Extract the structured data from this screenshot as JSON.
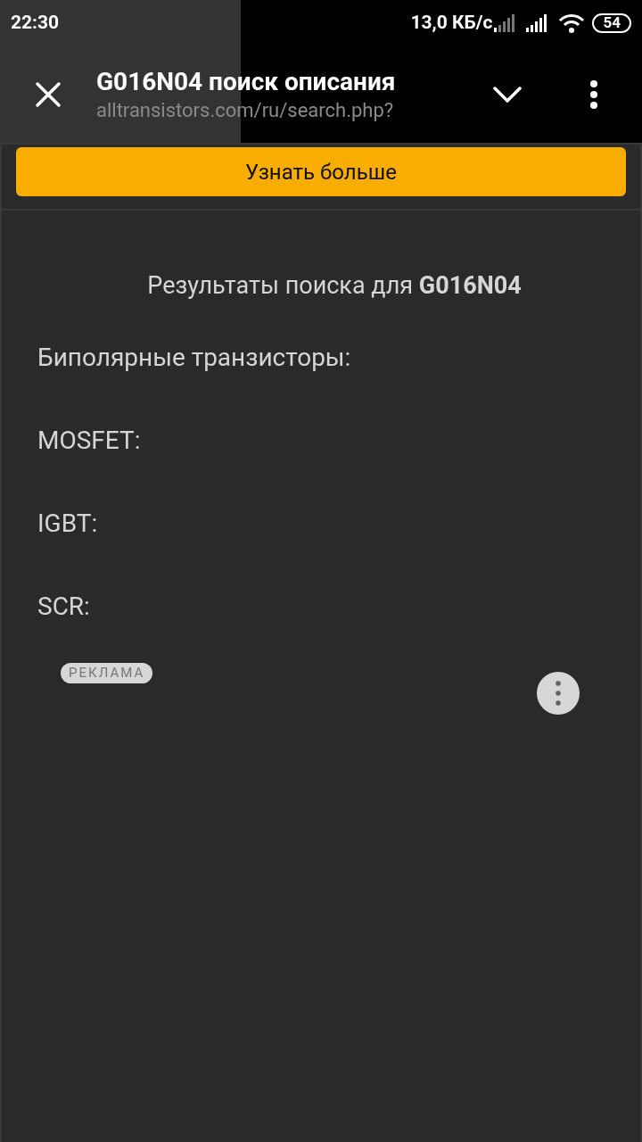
{
  "status_bar": {
    "time": "22:30",
    "speed": "13,0 КБ/с",
    "battery": "54"
  },
  "toolbar": {
    "title": "G016N04 поиск описания",
    "url": "alltransistors.com/ru/search.php?"
  },
  "promo_button": "Узнать больше",
  "heading": "Результаты поиска для **G016N04**",
  "sections": [
    "Биполярные транзисторы:",
    "MOSFET:",
    "IGBT:",
    "SCR:"
  ],
  "ad": {
    "badge": "РЕКЛАМА"
  }
}
